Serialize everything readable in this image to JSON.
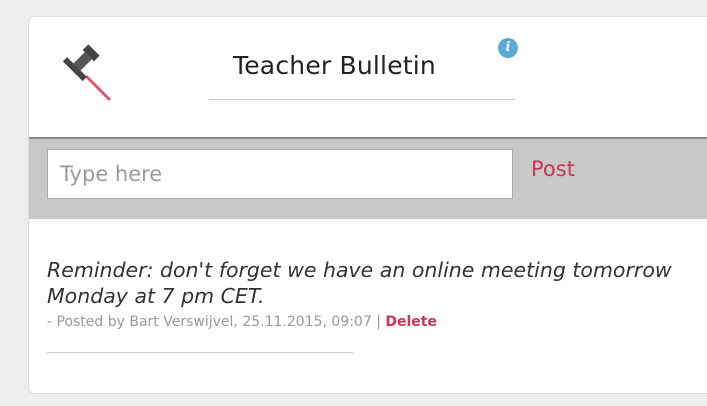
{
  "bulletin": {
    "title": "Teacher Bulletin",
    "pin_icon": "push-pin-icon",
    "info_icon": "info-icon",
    "info_glyph": "i",
    "accent_color": "#cc3355",
    "info_color": "#5aa9d6"
  },
  "composer": {
    "placeholder": "Type here",
    "value": "",
    "post_label": "Post"
  },
  "messages": [
    {
      "text": "Reminder: don't forget we have an online meeting tomorrow Monday at 7 pm CET.",
      "meta_prefix": "- Posted by Bart Verswijvel, 25.11.2015, 09:07 | ",
      "delete_label": "Delete"
    }
  ]
}
